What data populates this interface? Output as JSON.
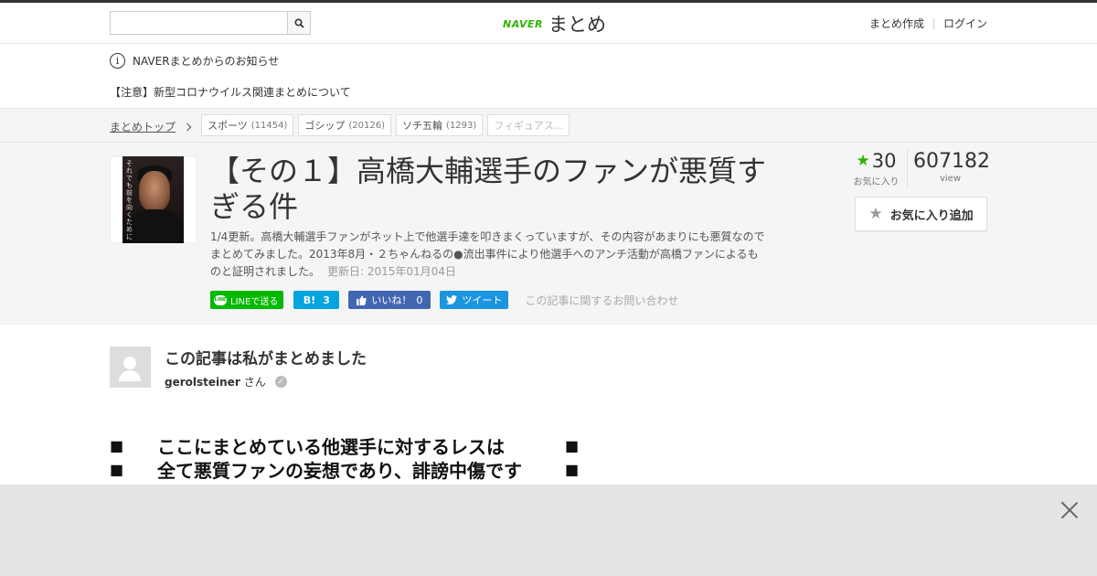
{
  "header": {
    "search_placeholder": "",
    "logo_brand": "NAVER",
    "logo_text": "まとめ",
    "links": [
      "まとめ作成",
      "ログイン"
    ]
  },
  "notice": {
    "title": "NAVERまとめからのお知らせ",
    "message": "【注意】新型コロナウイルス関連まとめについて"
  },
  "breadcrumb": {
    "top_label": "まとめトップ",
    "tags": [
      {
        "label": "スポーツ",
        "count": "(11454)"
      },
      {
        "label": "ゴシップ",
        "count": "(20126)"
      },
      {
        "label": "ソチ五輪",
        "count": "(1293)"
      },
      {
        "label": "フィギュアス...",
        "count": ""
      }
    ]
  },
  "article": {
    "thumb_text": "それでも前を向くために",
    "title": "【その１】高橋大輔選手のファンが悪質すぎる件",
    "description": "1/4更新。高橋大輔選手ファンがネット上で他選手達を叩きまくっていますが、その内容があまりにも悪質なのでまとめてみました。2013年8月・２ちゃんねるの●流出事件により他選手へのアンチ活動が高橋ファンによるものと証明されました。",
    "updated": "更新日: 2015年01月04日",
    "share": {
      "line": "LINEで送る",
      "hatena_label": "B!",
      "hatena_count": "3",
      "fb_label": "いいね！",
      "fb_count": "0",
      "tweet": "ツイート",
      "contact": "この記事に関するお問い合わせ"
    },
    "stats": {
      "favorites": "30",
      "favorites_label": "お気に入り",
      "views": "607182",
      "views_label": "view"
    },
    "fav_button": "お気に入り追加"
  },
  "author": {
    "heading": "この記事は私がまとめました",
    "name": "gerolsteiner",
    "suffix": "さん"
  },
  "content": {
    "lines": [
      "ここにまとめている他選手に対するレスは",
      "全て悪質ファンの妄想であり、誹謗中傷です"
    ],
    "marker": "■"
  },
  "colors": {
    "naver_green": "#2db400",
    "line_green": "#00b900",
    "hatena_blue": "#00a4de",
    "facebook_blue": "#4267b2",
    "twitter_blue": "#1b95e0"
  }
}
